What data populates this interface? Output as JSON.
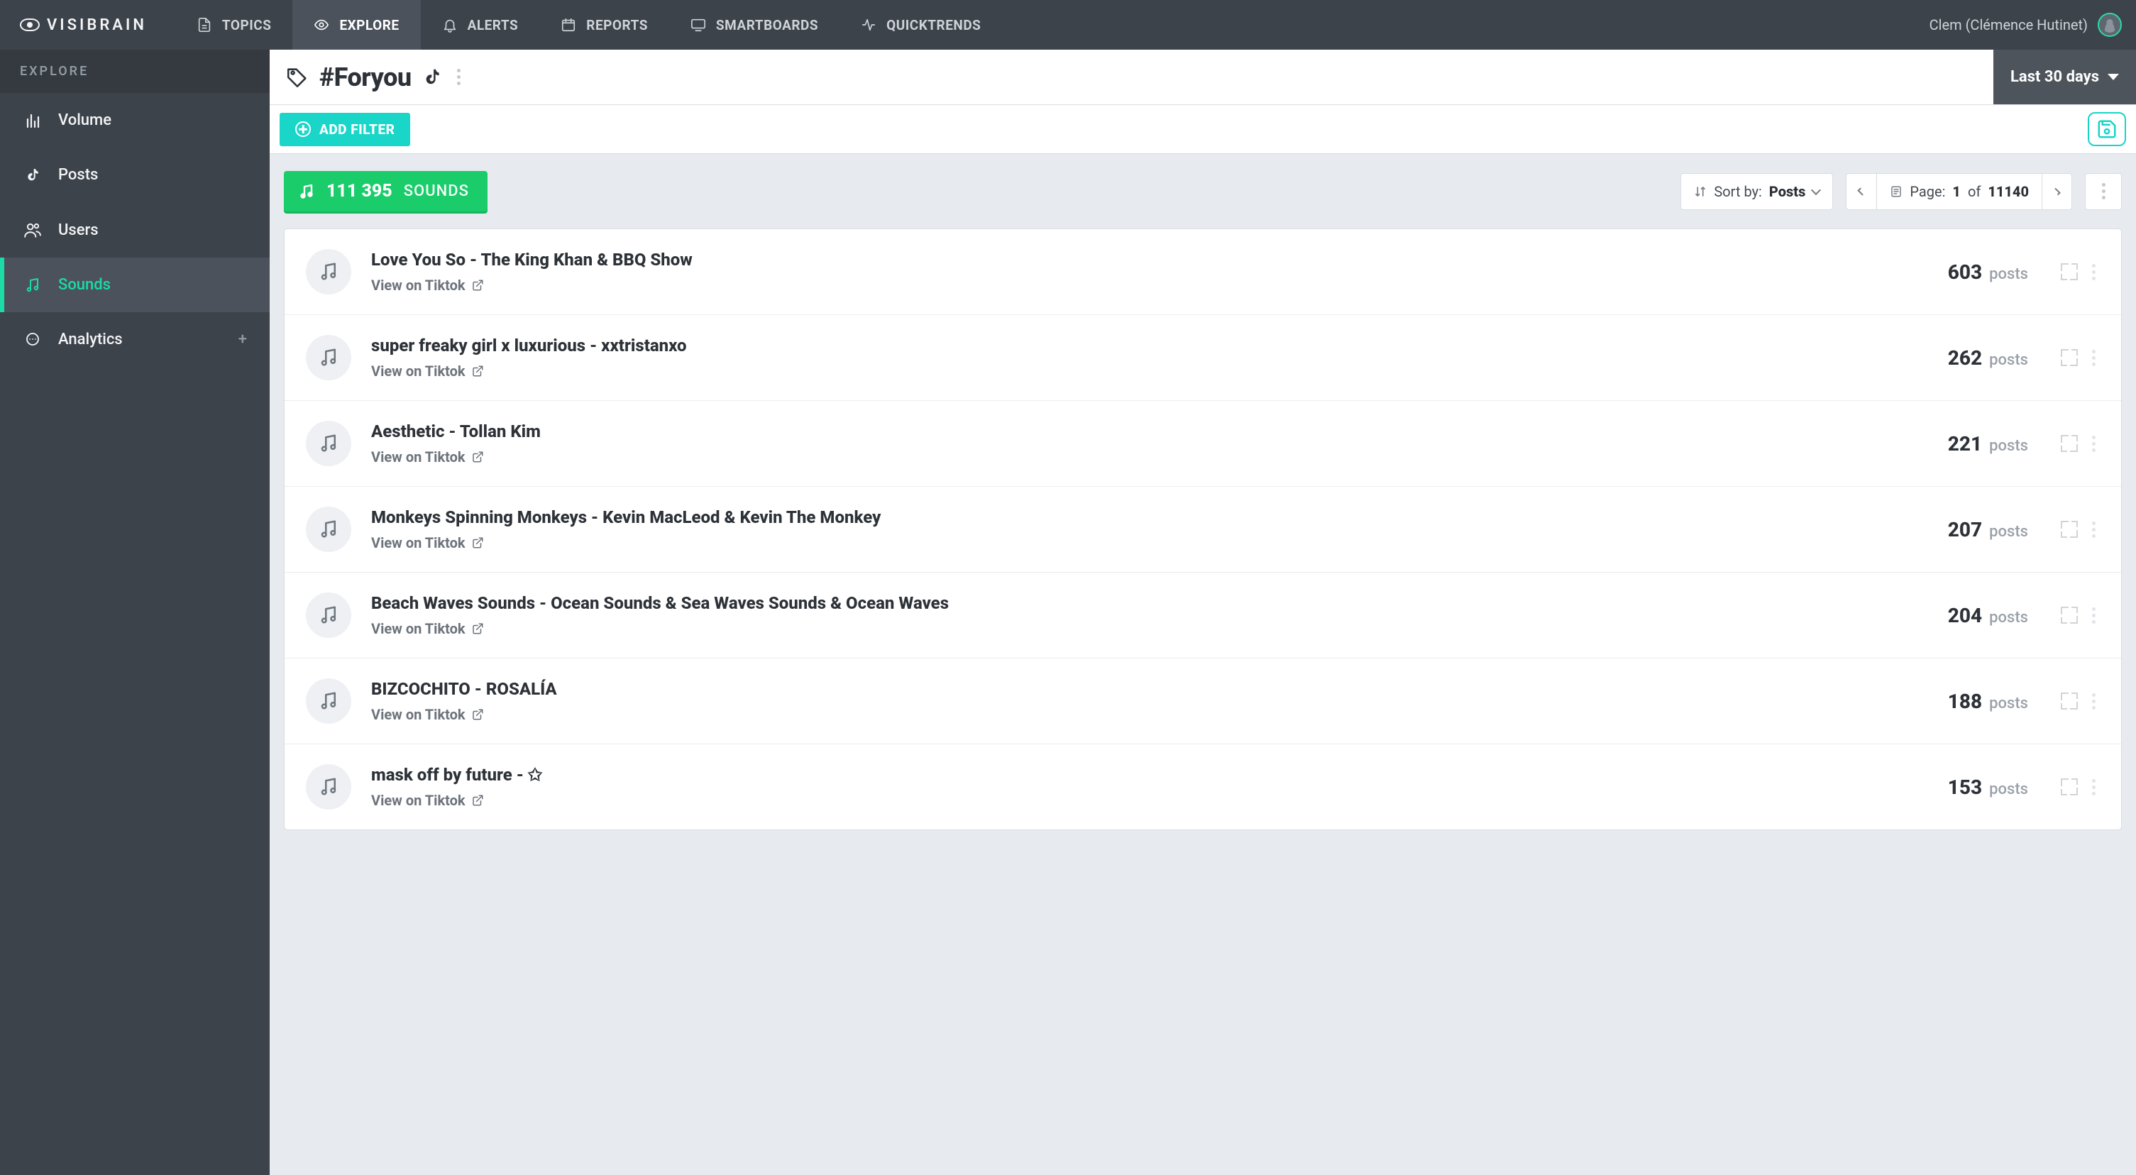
{
  "brand": "VISIBRAIN",
  "topnav": [
    {
      "label": "TOPICS",
      "icon": "file-icon",
      "active": false
    },
    {
      "label": "EXPLORE",
      "icon": "eye-icon",
      "active": true
    },
    {
      "label": "ALERTS",
      "icon": "bell-icon",
      "active": false
    },
    {
      "label": "REPORTS",
      "icon": "calendar-icon",
      "active": false
    },
    {
      "label": "SMARTBOARDS",
      "icon": "monitor-icon",
      "active": false
    },
    {
      "label": "QUICKTRENDS",
      "icon": "activity-icon",
      "active": false
    }
  ],
  "user_name": "Clem (Clémence Hutinet)",
  "side_header": "EXPLORE",
  "sidebar": [
    {
      "label": "Volume",
      "icon": "bars-icon",
      "active": false,
      "has_plus": false
    },
    {
      "label": "Posts",
      "icon": "tiktok-icon",
      "active": false,
      "has_plus": false
    },
    {
      "label": "Users",
      "icon": "users-icon",
      "active": false,
      "has_plus": false
    },
    {
      "label": "Sounds",
      "icon": "music-icon",
      "active": true,
      "has_plus": false
    },
    {
      "label": "Analytics",
      "icon": "speech-icon",
      "active": false,
      "has_plus": true
    }
  ],
  "page_title": "#Foryou",
  "date_range": "Last 30 days",
  "add_filter_label": "ADD FILTER",
  "count": {
    "value": "111 395",
    "unit": "SOUNDS"
  },
  "sort": {
    "prefix": "Sort by:",
    "value": "Posts"
  },
  "pager": {
    "prefix": "Page:",
    "current": "1",
    "of": "of",
    "total": "11140"
  },
  "view_link_label": "View on Tiktok",
  "posts_unit": "posts",
  "sounds": [
    {
      "title": "Love You So - The King Khan & BBQ Show",
      "posts": "603"
    },
    {
      "title": "super freaky girl x luxurious - xxtristanxo",
      "posts": "262"
    },
    {
      "title": "Aesthetic - Tollan Kim",
      "posts": "221"
    },
    {
      "title": "Monkeys Spinning Monkeys - Kevin MacLeod & Kevin The Monkey",
      "posts": "207"
    },
    {
      "title": "Beach Waves Sounds - Ocean Sounds & Sea Waves Sounds & Ocean Waves",
      "posts": "204"
    },
    {
      "title": "BIZCOCHITO - ROSALÍA",
      "posts": "188"
    },
    {
      "title": "mask off by future - ✩",
      "posts": "153"
    }
  ]
}
